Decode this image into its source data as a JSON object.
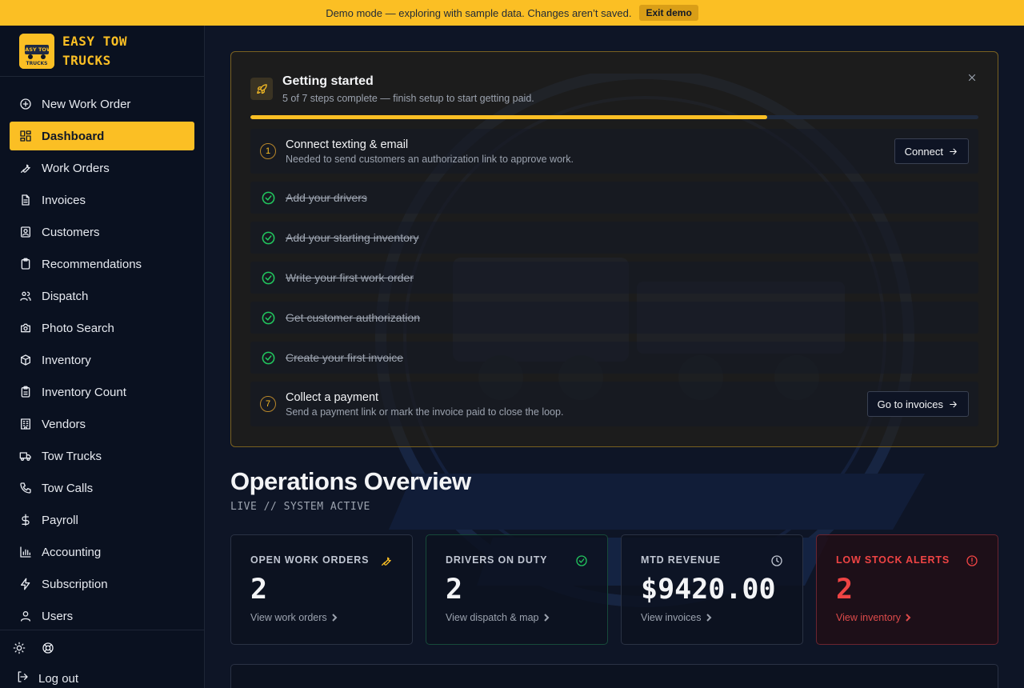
{
  "banner": {
    "text": "Demo mode — exploring with sample data. Changes aren’t saved.",
    "exit_label": "Exit demo"
  },
  "brand": {
    "name_line1": "EASY TOW",
    "name_line2": "TRUCKS",
    "logo_text_1": "EASY TOW",
    "logo_text_2": "TRUCKS"
  },
  "sidebar": {
    "items": [
      {
        "label": "New Work Order",
        "icon": "plus-circle-icon"
      },
      {
        "label": "Dashboard",
        "icon": "grid-icon",
        "active": true
      },
      {
        "label": "Work Orders",
        "icon": "wrench-icon"
      },
      {
        "label": "Invoices",
        "icon": "file-icon"
      },
      {
        "label": "Customers",
        "icon": "contact-icon"
      },
      {
        "label": "Recommendations",
        "icon": "clipboard-icon"
      },
      {
        "label": "Dispatch",
        "icon": "users-icon"
      },
      {
        "label": "Photo Search",
        "icon": "camera-icon"
      },
      {
        "label": "Inventory",
        "icon": "package-icon"
      },
      {
        "label": "Inventory Count",
        "icon": "clipboard-list-icon"
      },
      {
        "label": "Vendors",
        "icon": "building-icon"
      },
      {
        "label": "Tow Trucks",
        "icon": "truck-icon"
      },
      {
        "label": "Tow Calls",
        "icon": "phone-icon"
      },
      {
        "label": "Payroll",
        "icon": "dollar-icon"
      },
      {
        "label": "Accounting",
        "icon": "bar-chart-icon"
      },
      {
        "label": "Subscription",
        "icon": "zap-icon"
      },
      {
        "label": "Users",
        "icon": "user-icon"
      }
    ],
    "logout_label": "Log out"
  },
  "getting_started": {
    "title": "Getting started",
    "subtitle": "5 of 7 steps complete — finish setup to start getting paid.",
    "progress": 0.71,
    "steps": [
      {
        "num": "1",
        "title": "Connect texting & email",
        "desc": "Needed to send customers an authorization link to approve work.",
        "button": "Connect",
        "done": false
      },
      {
        "title": "Add your drivers",
        "done": true
      },
      {
        "title": "Add your starting inventory",
        "done": true
      },
      {
        "title": "Write your first work order",
        "done": true
      },
      {
        "title": "Get customer authorization",
        "done": true
      },
      {
        "title": "Create your first invoice",
        "done": true
      },
      {
        "num": "7",
        "title": "Collect a payment",
        "desc": "Send a payment link or mark the invoice paid to close the loop.",
        "button": "Go to invoices",
        "done": false
      }
    ]
  },
  "overview": {
    "title": "Operations Overview",
    "subtitle": "LIVE // SYSTEM ACTIVE",
    "stats": [
      {
        "label": "OPEN WORK ORDERS",
        "value": "2",
        "link": "View work orders",
        "icon": "wrench-icon"
      },
      {
        "label": "DRIVERS ON DUTY",
        "value": "2",
        "link": "View dispatch & map",
        "icon": "check-circle-icon"
      },
      {
        "label": "MTD REVENUE",
        "value": "$9420.00",
        "link": "View invoices",
        "icon": "clock-icon"
      },
      {
        "label": "LOW STOCK ALERTS",
        "value": "2",
        "link": "View inventory",
        "icon": "alert-circle-icon"
      }
    ]
  },
  "colors": {
    "accent": "#fbbf24",
    "success": "#22c55e",
    "danger": "#ef4444",
    "background": "#0e1526"
  }
}
